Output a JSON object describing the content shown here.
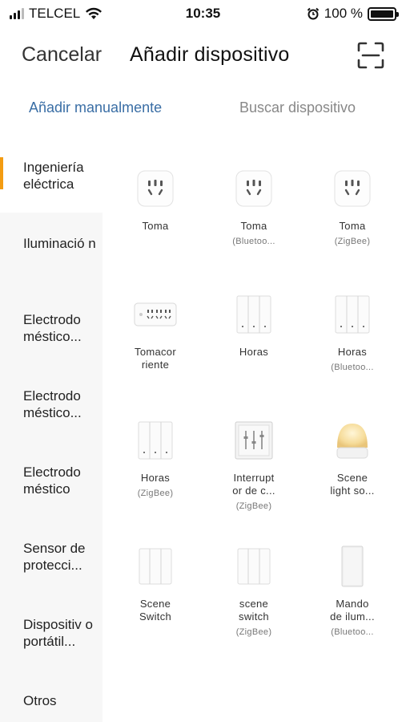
{
  "status_bar": {
    "carrier": "TELCEL",
    "time": "10:35",
    "battery": "100 %"
  },
  "header": {
    "cancel_label": "Cancelar",
    "title": "Añadir dispositivo",
    "scan_icon": "scan-icon"
  },
  "tabs": {
    "manual": "Añadir manualmente",
    "search": "Buscar dispositivo"
  },
  "accent_colors": {
    "active_tab": "#3a6ea5",
    "sidebar_indicator": "#f39c12"
  },
  "sidebar": {
    "items": [
      {
        "label": "Ingeniería eléctrica"
      },
      {
        "label": "Iluminació n"
      },
      {
        "label": "Electrodo méstico..."
      },
      {
        "label": "Electrodo méstico..."
      },
      {
        "label": "Electrodo méstico"
      },
      {
        "label": "Sensor de protecci..."
      },
      {
        "label": "Dispositiv o portátil..."
      },
      {
        "label": "Otros"
      }
    ]
  },
  "devices": [
    {
      "name": "Toma",
      "sub": "",
      "icon": "socket-icon"
    },
    {
      "name": "Toma",
      "sub": "(Bluetoo...",
      "icon": "socket-icon"
    },
    {
      "name": "Toma",
      "sub": "(ZigBee)",
      "icon": "socket-icon"
    },
    {
      "name": "Tomacor riente",
      "sub": "",
      "icon": "power-strip-icon"
    },
    {
      "name": "Horas",
      "sub": "",
      "icon": "triple-switch-icon"
    },
    {
      "name": "Horas",
      "sub": "(Bluetoo...",
      "icon": "triple-switch-icon"
    },
    {
      "name": "Horas",
      "sub": "(ZigBee)",
      "icon": "triple-switch-icon"
    },
    {
      "name": "Interrupt or de c...",
      "sub": "(ZigBee)",
      "icon": "curtain-switch-icon"
    },
    {
      "name": "Scene light so...",
      "sub": "",
      "icon": "night-light-icon"
    },
    {
      "name": "Scene Switch",
      "sub": "",
      "icon": "scene-switch-icon"
    },
    {
      "name": "scene switch",
      "sub": "(ZigBee)",
      "icon": "scene-switch-icon"
    },
    {
      "name": "Mando de ilum...",
      "sub": "(Bluetoo...",
      "icon": "remote-icon"
    }
  ]
}
